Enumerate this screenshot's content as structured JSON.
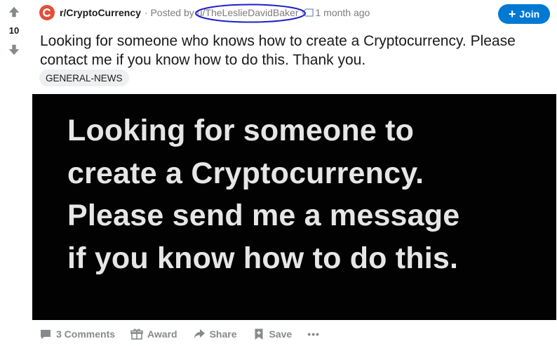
{
  "vote": {
    "score": "10"
  },
  "post": {
    "subreddit": "r/CryptoCurrency",
    "subreddit_icon_letter": "C",
    "posted_by_prefix": "· Posted by",
    "author": "u/TheLeslieDavidBaker",
    "time_ago": "1 month ago",
    "join_label": "Join",
    "title": "Looking for someone who knows how to create a Cryptocurrency. Please contact me if you know how to do this. Thank you.",
    "flair": "GENERAL-NEWS",
    "image_text": "Looking for someone to\ncreate a Cryptocurrency.\nPlease send me a message\nif you know how to do this."
  },
  "actions": {
    "comments": "3 Comments",
    "award": "Award",
    "share": "Share",
    "save": "Save",
    "more": "•••"
  },
  "colors": {
    "accent": "#0079d3",
    "subreddit_icon": "#e34f3c",
    "annotation_circle": "#1f1fc8"
  },
  "icons": [
    "upvote-icon",
    "downvote-icon",
    "subreddit-icon",
    "award-tag-icon",
    "comment-icon",
    "award-icon",
    "share-icon",
    "save-icon",
    "more-icon"
  ]
}
